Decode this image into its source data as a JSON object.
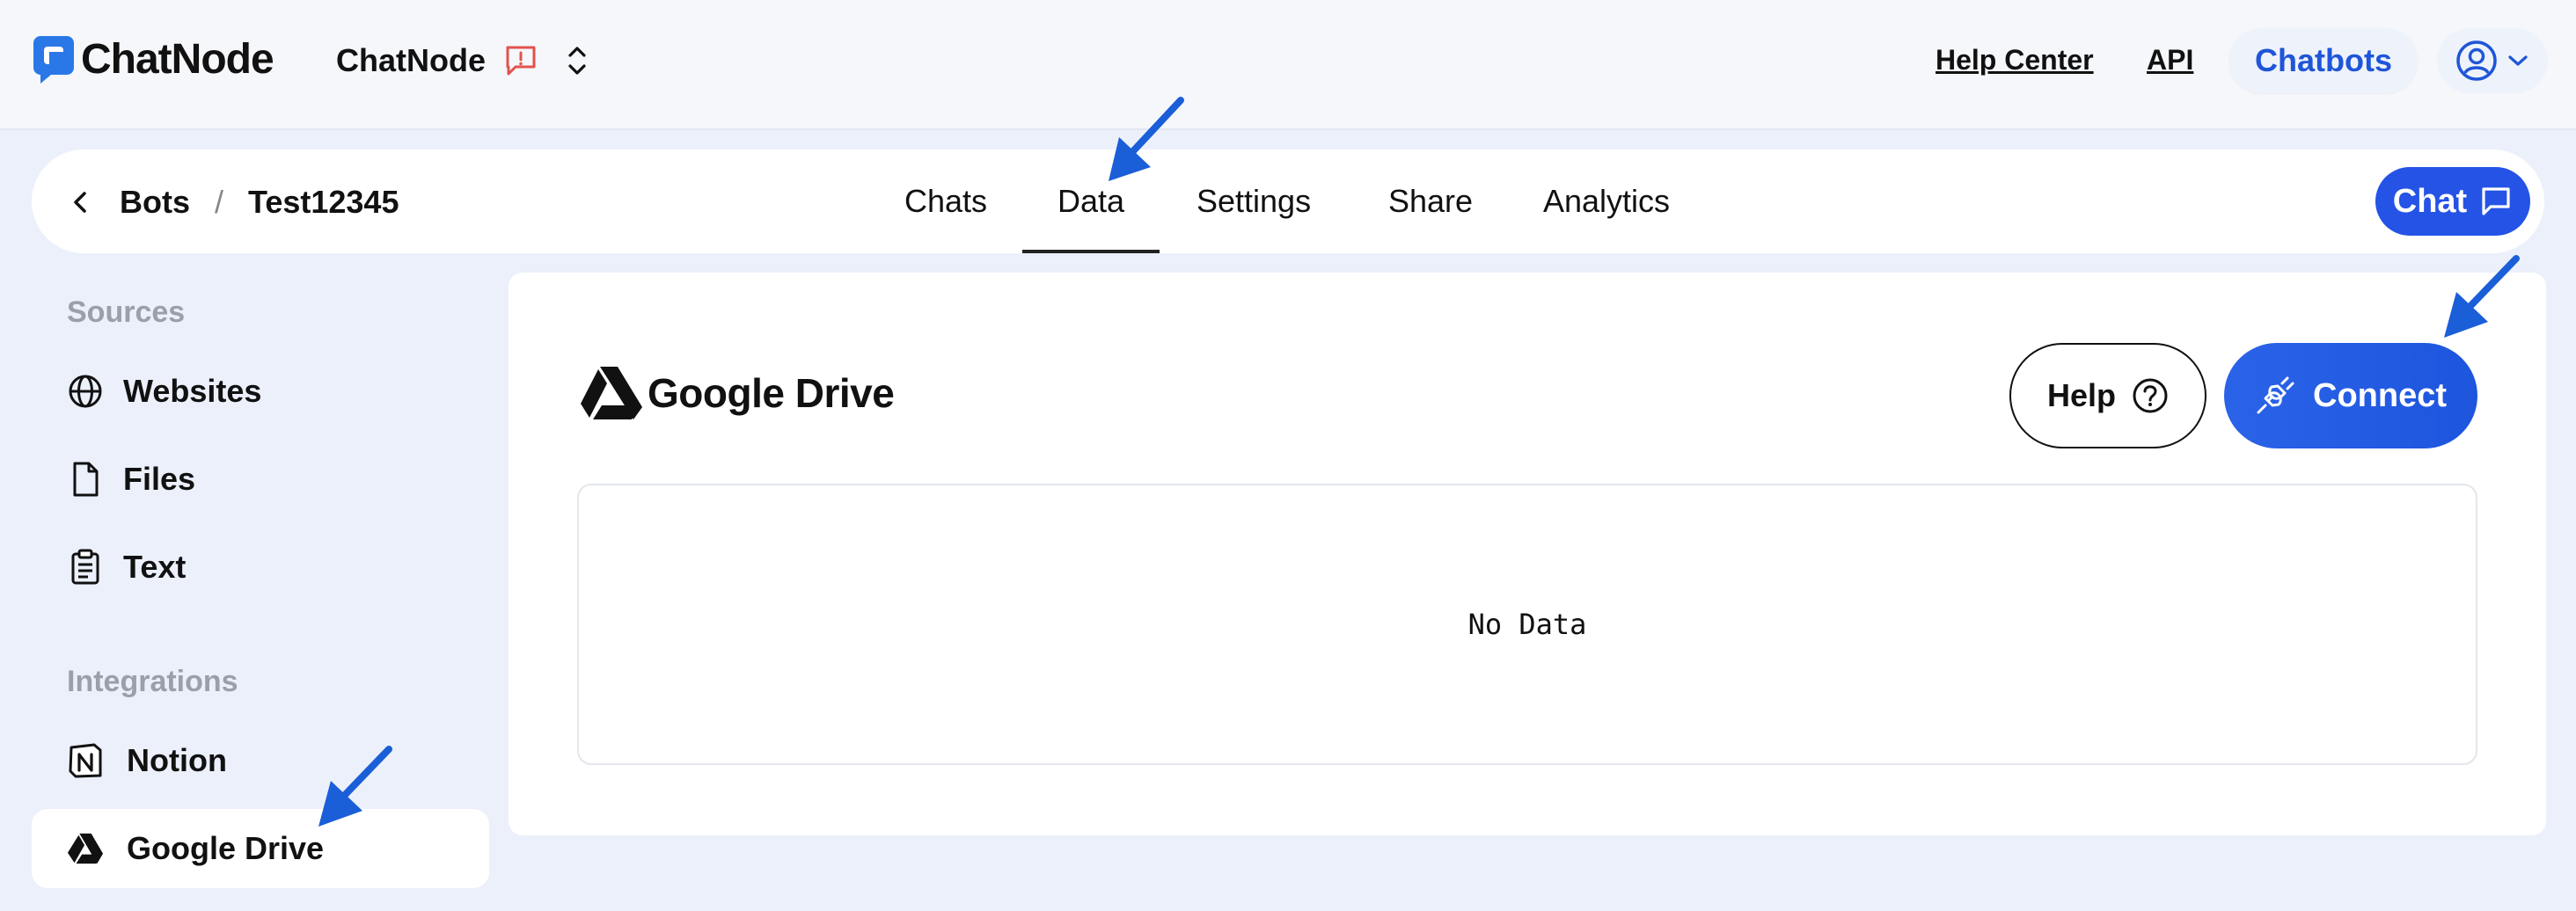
{
  "header": {
    "logo_text": "ChatNode",
    "workspace_name": "ChatNode",
    "links": {
      "help_center": "Help Center",
      "api": "API"
    },
    "chatbots_label": "Chatbots"
  },
  "breadcrumb": {
    "back_icon": "chevron-left-icon",
    "parent": "Bots",
    "separator": "/",
    "current": "Test12345"
  },
  "tabs": [
    {
      "label": "Chats",
      "active": false
    },
    {
      "label": "Data",
      "active": true
    },
    {
      "label": "Settings",
      "active": false
    },
    {
      "label": "Share",
      "active": false
    },
    {
      "label": "Analytics",
      "active": false
    }
  ],
  "chat_button": {
    "label": "Chat"
  },
  "sidebar": {
    "sources_title": "Sources",
    "sources": [
      {
        "label": "Websites",
        "icon": "globe-icon"
      },
      {
        "label": "Files",
        "icon": "file-icon"
      },
      {
        "label": "Text",
        "icon": "clipboard-icon"
      }
    ],
    "integrations_title": "Integrations",
    "integrations": [
      {
        "label": "Notion",
        "icon": "notion-icon"
      },
      {
        "label": "Google Drive",
        "icon": "google-drive-icon",
        "selected": true
      }
    ]
  },
  "main": {
    "title": "Google Drive",
    "help_label": "Help",
    "connect_label": "Connect",
    "empty_text": "No Data"
  },
  "colors": {
    "accent": "#2453e6",
    "background": "#ebf0fa",
    "arrow": "#1a5ed8"
  }
}
